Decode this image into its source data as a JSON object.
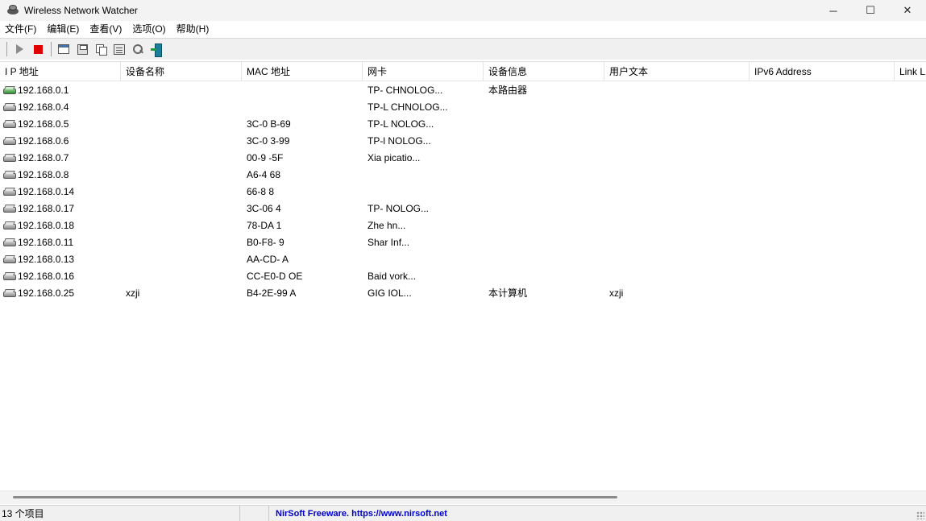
{
  "window": {
    "title": "Wireless Network Watcher",
    "minimize_glyph": "─",
    "maximize_glyph": "☐",
    "close_glyph": "✕"
  },
  "menu": [
    "文件(F)",
    "编辑(E)",
    "查看(V)",
    "选项(O)",
    "帮助(H)"
  ],
  "toolbar": {
    "buttons": [
      "play-icon",
      "stop-icon",
      "properties-icon",
      "save-icon",
      "copy-icon",
      "html-report-icon",
      "find-icon",
      "exit-icon"
    ]
  },
  "columns": [
    "I P 地址",
    "设备名称",
    "MAC 地址",
    "网卡",
    "设备信息",
    "用户文本",
    "IPv6 Address",
    "Link L"
  ],
  "rows": [
    {
      "ip": "192.168.0.1",
      "name": "",
      "mac": "",
      "adapter": "TP-    CHNOLOG...",
      "info": "本路由器",
      "text": "",
      "icon": "router-icon"
    },
    {
      "ip": "192.168.0.4",
      "name": "",
      "mac": "",
      "adapter": "TP-L       CHNOLOG...",
      "info": "",
      "text": "",
      "icon": "device-icon"
    },
    {
      "ip": "192.168.0.5",
      "name": "",
      "mac": "3C-0           B-69",
      "adapter": "TP-L       NOLOG...",
      "info": "",
      "text": "",
      "icon": "device-icon"
    },
    {
      "ip": "192.168.0.6",
      "name": "",
      "mac": "3C-0           3-99",
      "adapter": "TP-l        NOLOG...",
      "info": "",
      "text": "",
      "icon": "device-icon"
    },
    {
      "ip": "192.168.0.7",
      "name": "",
      "mac": "00-9            -5F",
      "adapter": "Xia                picatio...",
      "info": "",
      "text": "",
      "icon": "device-icon"
    },
    {
      "ip": "192.168.0.8",
      "name": "",
      "mac": "A6-4             68",
      "adapter": "",
      "info": "",
      "text": "",
      "icon": "device-icon"
    },
    {
      "ip": "192.168.0.14",
      "name": "",
      "mac": "66-8            8",
      "adapter": "",
      "info": "",
      "text": "",
      "icon": "device-icon"
    },
    {
      "ip": "192.168.0.17",
      "name": "",
      "mac": "3C-06          4",
      "adapter": "TP-          NOLOG...",
      "info": "",
      "text": "",
      "icon": "device-icon"
    },
    {
      "ip": "192.168.0.18",
      "name": "",
      "mac": "78-DA            1",
      "adapter": "Zhe              hn...",
      "info": "",
      "text": "",
      "icon": "device-icon"
    },
    {
      "ip": "192.168.0.11",
      "name": "",
      "mac": "B0-F8-           9",
      "adapter": "Shar              Inf...",
      "info": "",
      "text": "",
      "icon": "device-icon"
    },
    {
      "ip": "192.168.0.13",
      "name": "",
      "mac": "AA-CD-           A",
      "adapter": "",
      "info": "",
      "text": "",
      "icon": "device-icon"
    },
    {
      "ip": "192.168.0.16",
      "name": "",
      "mac": "CC-E0-D          OE",
      "adapter": "Baid              vork...",
      "info": "",
      "text": "",
      "icon": "device-icon"
    },
    {
      "ip": "192.168.0.25",
      "name": "xzji",
      "mac": "B4-2E-99         A",
      "adapter": "GIG              IOL...",
      "info": "本计算机",
      "text": "xzji",
      "icon": "device-icon"
    }
  ],
  "status": {
    "count": "13 个项目",
    "link": "NirSoft Freeware. https://www.nirsoft.net"
  }
}
